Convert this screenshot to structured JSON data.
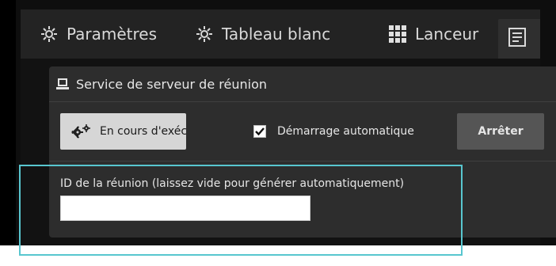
{
  "tabs": [
    {
      "label": "Paramètres",
      "icon": "settings-icon"
    },
    {
      "label": "Tableau blanc",
      "icon": "whiteboard-icon"
    },
    {
      "label": "Lanceur",
      "icon": "launcher-grid-icon"
    }
  ],
  "active_tab": {
    "icon": "document-icon"
  },
  "service_panel": {
    "title": "Service de serveur de réunion",
    "icon": "server-icon",
    "status_button": {
      "label": "En cours d'exécuti",
      "icon": "gears-icon"
    },
    "autostart": {
      "label": "Démarrage automatique",
      "checked": true
    },
    "stop_button": {
      "label": "Arrêter"
    }
  },
  "meeting_id": {
    "label": "ID de la réunion (laissez vide pour générer automatiquement)",
    "value": "",
    "placeholder": ""
  },
  "colors": {
    "highlight": "#58c6cf",
    "panel_bg": "#2d2d2d",
    "tabbar_bg": "#232323"
  }
}
